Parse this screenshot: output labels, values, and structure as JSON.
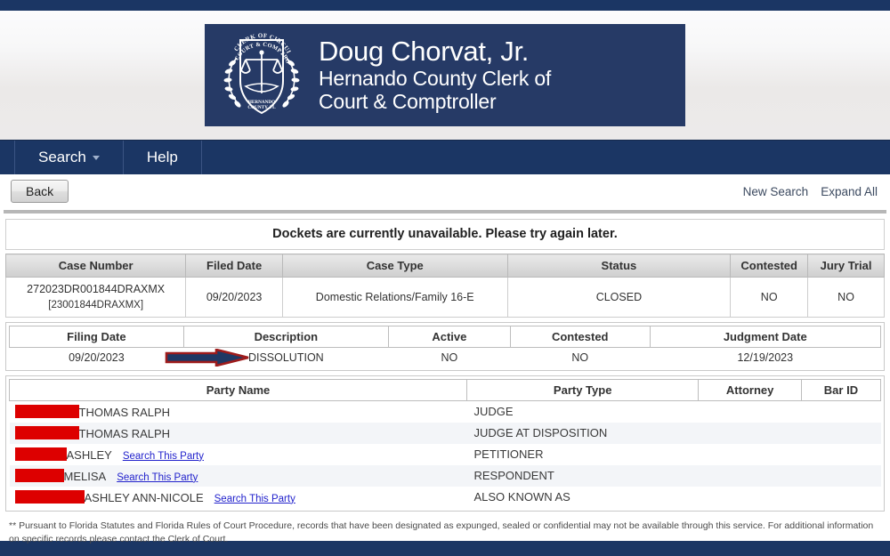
{
  "brand": {
    "accent_navy": "#1b3664",
    "banner_navy": "#263a66",
    "redaction_red": "#dd0000",
    "agency_name": "Doug Chorvat, Jr.",
    "agency_sub_line1": "Hernando County Clerk of",
    "agency_sub_line2": "Court & Comptroller",
    "seal_top_text": "CLERK OF CIRCUIT",
    "seal_top_text2": "COURT & COMPTROLLER",
    "seal_bottom_text": "HERNANDO",
    "seal_bottom_text2": "COUNTY, FL"
  },
  "nav": {
    "items": [
      {
        "label": "Search",
        "has_caret": true
      },
      {
        "label": "Help",
        "has_caret": false
      }
    ]
  },
  "toolbar": {
    "back_label": "Back",
    "links": [
      {
        "label": "New Search"
      },
      {
        "label": "Expand All"
      }
    ]
  },
  "notice": {
    "message": "Dockets are currently unavailable. Please try again later."
  },
  "case_table": {
    "headers": [
      "Case Number",
      "Filed Date",
      "Case Type",
      "Status",
      "Contested",
      "Jury Trial"
    ],
    "rows": [
      {
        "case_number": "272023DR001844DRAXMX",
        "case_number_alt": "[23001844DRAXMX]",
        "filed_date": "09/20/2023",
        "case_type": "Domestic Relations/Family 16-E",
        "status": "CLOSED",
        "contested": "NO",
        "jury_trial": "NO"
      }
    ]
  },
  "filing_table": {
    "headers": [
      "Filing Date",
      "Description",
      "Active",
      "Contested",
      "Judgment Date"
    ],
    "rows": [
      {
        "filing_date": "09/20/2023",
        "description": "DISSOLUTION",
        "active": "NO",
        "contested": "NO",
        "judgment_date": "12/19/2023"
      }
    ]
  },
  "party_table": {
    "headers": [
      "Party Name",
      "Party Type",
      "Attorney",
      "Bar ID"
    ],
    "rows": [
      {
        "redaction_width": 72,
        "party_name": "THOMAS RALPH",
        "search_link": "",
        "party_type": "JUDGE",
        "attorney": "",
        "bar_id": ""
      },
      {
        "redaction_width": 72,
        "party_name": "THOMAS RALPH",
        "search_link": "",
        "party_type": "JUDGE AT DISPOSITION",
        "attorney": "",
        "bar_id": ""
      },
      {
        "redaction_width": 58,
        "party_name": "ASHLEY",
        "search_link": "Search This Party",
        "party_type": "PETITIONER",
        "attorney": "",
        "bar_id": ""
      },
      {
        "redaction_width": 55,
        "party_name": "MELISA",
        "search_link": "Search This Party",
        "party_type": "RESPONDENT",
        "attorney": "",
        "bar_id": ""
      },
      {
        "redaction_width": 78,
        "party_name": "ASHLEY ANN-NICOLE",
        "search_link": "Search This Party",
        "party_type": "ALSO KNOWN AS",
        "attorney": "",
        "bar_id": ""
      }
    ]
  },
  "footnote": {
    "text": "** Pursuant to Florida Statutes and Florida Rules of Court Procedure, records that have been designated as expunged, sealed or confidential may not be available through this service. For additional information on specific records please contact the Clerk of Court."
  },
  "annotation": {
    "arrow_fill": "#1f3864",
    "arrow_stroke": "#9e1b1b",
    "points_to": "DISSOLUTION"
  }
}
